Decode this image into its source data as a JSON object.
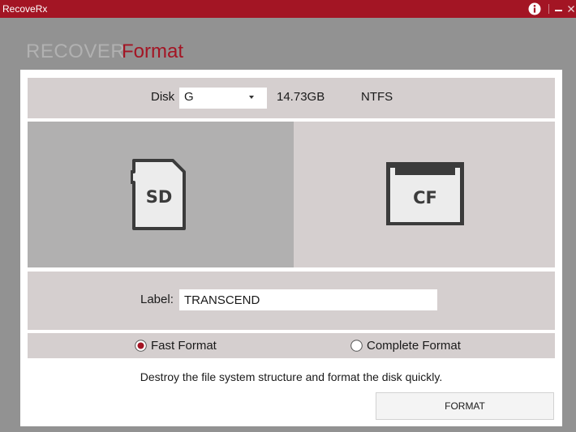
{
  "window": {
    "title": "RecoveRx"
  },
  "titlebar_icons": [
    "info-icon",
    "minimize-icon",
    "close-icon"
  ],
  "nav": {
    "recover_label": "RECOVER",
    "format_label": "Format",
    "active": "Format"
  },
  "disk": {
    "label": "Disk",
    "selected": "G",
    "size": "14.73GB",
    "filesystem": "NTFS"
  },
  "card_types": [
    {
      "label": "SD",
      "selected": true
    },
    {
      "label": "CF",
      "selected": false
    }
  ],
  "volume_label": {
    "label": "Label:",
    "value": "TRANSCEND"
  },
  "format_modes": [
    {
      "label": "Fast Format",
      "checked": true
    },
    {
      "label": "Complete Format",
      "checked": false
    }
  ],
  "description": "Destroy the file system structure and format the disk quickly.",
  "format_button_label": "FORMAT",
  "colors": {
    "accent": "#a31524",
    "window_bg": "#929292",
    "panel_bg": "#d5cfcf",
    "selected_tile": "#b1b0b0"
  }
}
